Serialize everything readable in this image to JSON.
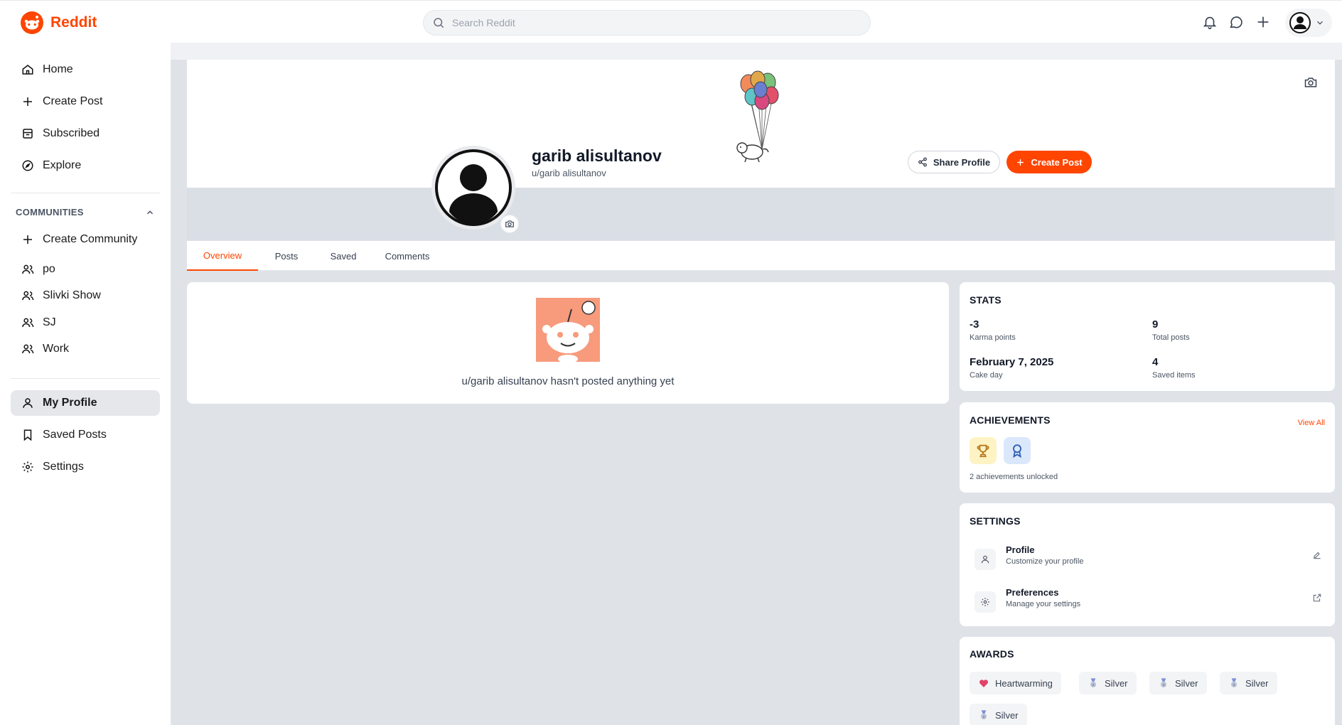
{
  "header": {
    "logo_text": "Reddit",
    "search_placeholder": "Search Reddit",
    "icons": [
      "bell-icon",
      "chat-icon",
      "plus-icon",
      "user-avatar",
      "chevron-down-icon"
    ]
  },
  "sidebar": {
    "primary": [
      {
        "label": "Home",
        "icon": "home-icon"
      },
      {
        "label": "Create Post",
        "icon": "plus-icon"
      },
      {
        "label": "Subscribed",
        "icon": "inbox-icon"
      },
      {
        "label": "Explore",
        "icon": "compass-icon"
      }
    ],
    "communities_title": "COMMUNITIES",
    "communities": [
      {
        "label": "Create Community",
        "icon": "plus-icon"
      },
      {
        "label": "po",
        "icon": "users-icon"
      },
      {
        "label": "Slivki Show",
        "icon": "users-icon"
      },
      {
        "label": "SJ",
        "icon": "users-icon"
      },
      {
        "label": "Work",
        "icon": "users-icon"
      }
    ],
    "account": [
      {
        "label": "My Profile",
        "icon": "user-icon",
        "active": true
      },
      {
        "label": "Saved Posts",
        "icon": "bookmark-icon"
      },
      {
        "label": "Settings",
        "icon": "gear-icon"
      }
    ]
  },
  "profile": {
    "display_name": "garib alisultanov",
    "handle": "u/garib alisultanov",
    "share_label": "Share Profile",
    "create_label": "Create Post"
  },
  "tabs": [
    "Overview",
    "Posts",
    "Saved",
    "Comments"
  ],
  "active_tab": "Overview",
  "empty_state": "u/garib alisultanov hasn't posted anything yet",
  "stats": {
    "title": "STATS",
    "karma_value": "-3",
    "karma_label": "Karma points",
    "posts_value": "9",
    "posts_label": "Total posts",
    "cake_value": "February 7, 2025",
    "cake_label": "Cake day",
    "saved_value": "4",
    "saved_label": "Saved items"
  },
  "achievements": {
    "title": "ACHIEVEMENTS",
    "view_all": "View All",
    "icons": [
      "trophy-icon",
      "ribbon-icon"
    ],
    "summary": "2 achievements unlocked"
  },
  "settings": {
    "title": "SETTINGS",
    "items": [
      {
        "title": "Profile",
        "subtitle": "Customize your profile",
        "icon": "user-icon"
      },
      {
        "title": "Preferences",
        "subtitle": "Manage your settings",
        "icon": "gear-icon"
      }
    ]
  },
  "awards": {
    "title": "AWARDS",
    "items": [
      {
        "label": "Heartwarming",
        "icon": "heart-icon"
      },
      {
        "label": "Silver",
        "icon": "medal-icon"
      },
      {
        "label": "Silver",
        "icon": "medal-icon"
      },
      {
        "label": "Silver",
        "icon": "medal-icon"
      },
      {
        "label": "Silver",
        "icon": "medal-icon"
      }
    ]
  },
  "colors": {
    "accent": "#ff4500",
    "page_bg": "#dfe3e8",
    "snoo_bg": "#f79b7c"
  }
}
